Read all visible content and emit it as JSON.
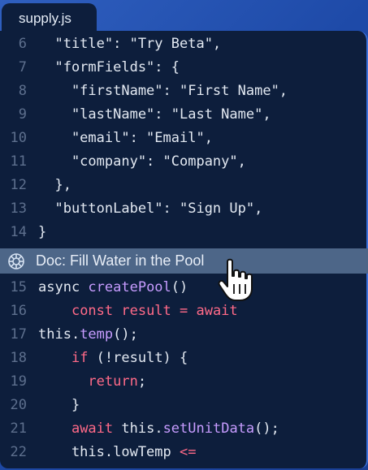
{
  "tab": {
    "filename": "supply.js"
  },
  "codelens": {
    "label": "Doc: Fill Water in the Pool",
    "icon": "gear-icon"
  },
  "colors": {
    "background": "#0d1e3c",
    "keyword": "#ff6a88",
    "function": "#c79cff",
    "line_number": "#5d6f8d",
    "codelens_bg": "#4d6688"
  },
  "lines": [
    {
      "num": "6",
      "tokens": [
        {
          "t": "  \"title\": \"Try Beta\",",
          "c": "def"
        }
      ]
    },
    {
      "num": "7",
      "tokens": [
        {
          "t": "  \"formFields\": {",
          "c": "def"
        }
      ]
    },
    {
      "num": "8",
      "tokens": [
        {
          "t": "    \"firstName\": \"First Name\",",
          "c": "def"
        }
      ]
    },
    {
      "num": "9",
      "tokens": [
        {
          "t": "    \"lastName\": \"Last Name\",",
          "c": "def"
        }
      ]
    },
    {
      "num": "10",
      "tokens": [
        {
          "t": "    \"email\": \"Email\",",
          "c": "def"
        }
      ]
    },
    {
      "num": "11",
      "tokens": [
        {
          "t": "    \"company\": \"Company\",",
          "c": "def"
        }
      ]
    },
    {
      "num": "12",
      "tokens": [
        {
          "t": "  },",
          "c": "def"
        }
      ]
    },
    {
      "num": "13",
      "tokens": [
        {
          "t": "  \"buttonLabel\": \"Sign Up\",",
          "c": "def"
        }
      ]
    },
    {
      "num": "14",
      "tokens": [
        {
          "t": "}",
          "c": "def"
        }
      ]
    },
    {
      "num": "15",
      "tokens": [
        {
          "t": "async ",
          "c": "def"
        },
        {
          "t": "createPool",
          "c": "fn"
        },
        {
          "t": "()",
          "c": "def"
        }
      ]
    },
    {
      "num": "16",
      "tokens": [
        {
          "t": "    ",
          "c": "def"
        },
        {
          "t": "const result = await",
          "c": "kw"
        }
      ]
    },
    {
      "num": "17",
      "tokens": [
        {
          "t": "this.",
          "c": "def"
        },
        {
          "t": "temp",
          "c": "fn"
        },
        {
          "t": "();",
          "c": "def"
        }
      ]
    },
    {
      "num": "18",
      "tokens": [
        {
          "t": "    ",
          "c": "def"
        },
        {
          "t": "if",
          "c": "kw"
        },
        {
          "t": " (!result) {",
          "c": "def"
        }
      ]
    },
    {
      "num": "19",
      "tokens": [
        {
          "t": "      ",
          "c": "def"
        },
        {
          "t": "return",
          "c": "kw"
        },
        {
          "t": ";",
          "c": "def"
        }
      ]
    },
    {
      "num": "20",
      "tokens": [
        {
          "t": "    }",
          "c": "def"
        }
      ]
    },
    {
      "num": "21",
      "tokens": [
        {
          "t": "    ",
          "c": "def"
        },
        {
          "t": "await",
          "c": "kw"
        },
        {
          "t": " this.",
          "c": "def"
        },
        {
          "t": "setUnitData",
          "c": "fn"
        },
        {
          "t": "();",
          "c": "def"
        }
      ]
    },
    {
      "num": "22",
      "tokens": [
        {
          "t": "    this.lowTemp ",
          "c": "def"
        },
        {
          "t": "<=",
          "c": "kw"
        }
      ]
    }
  ]
}
